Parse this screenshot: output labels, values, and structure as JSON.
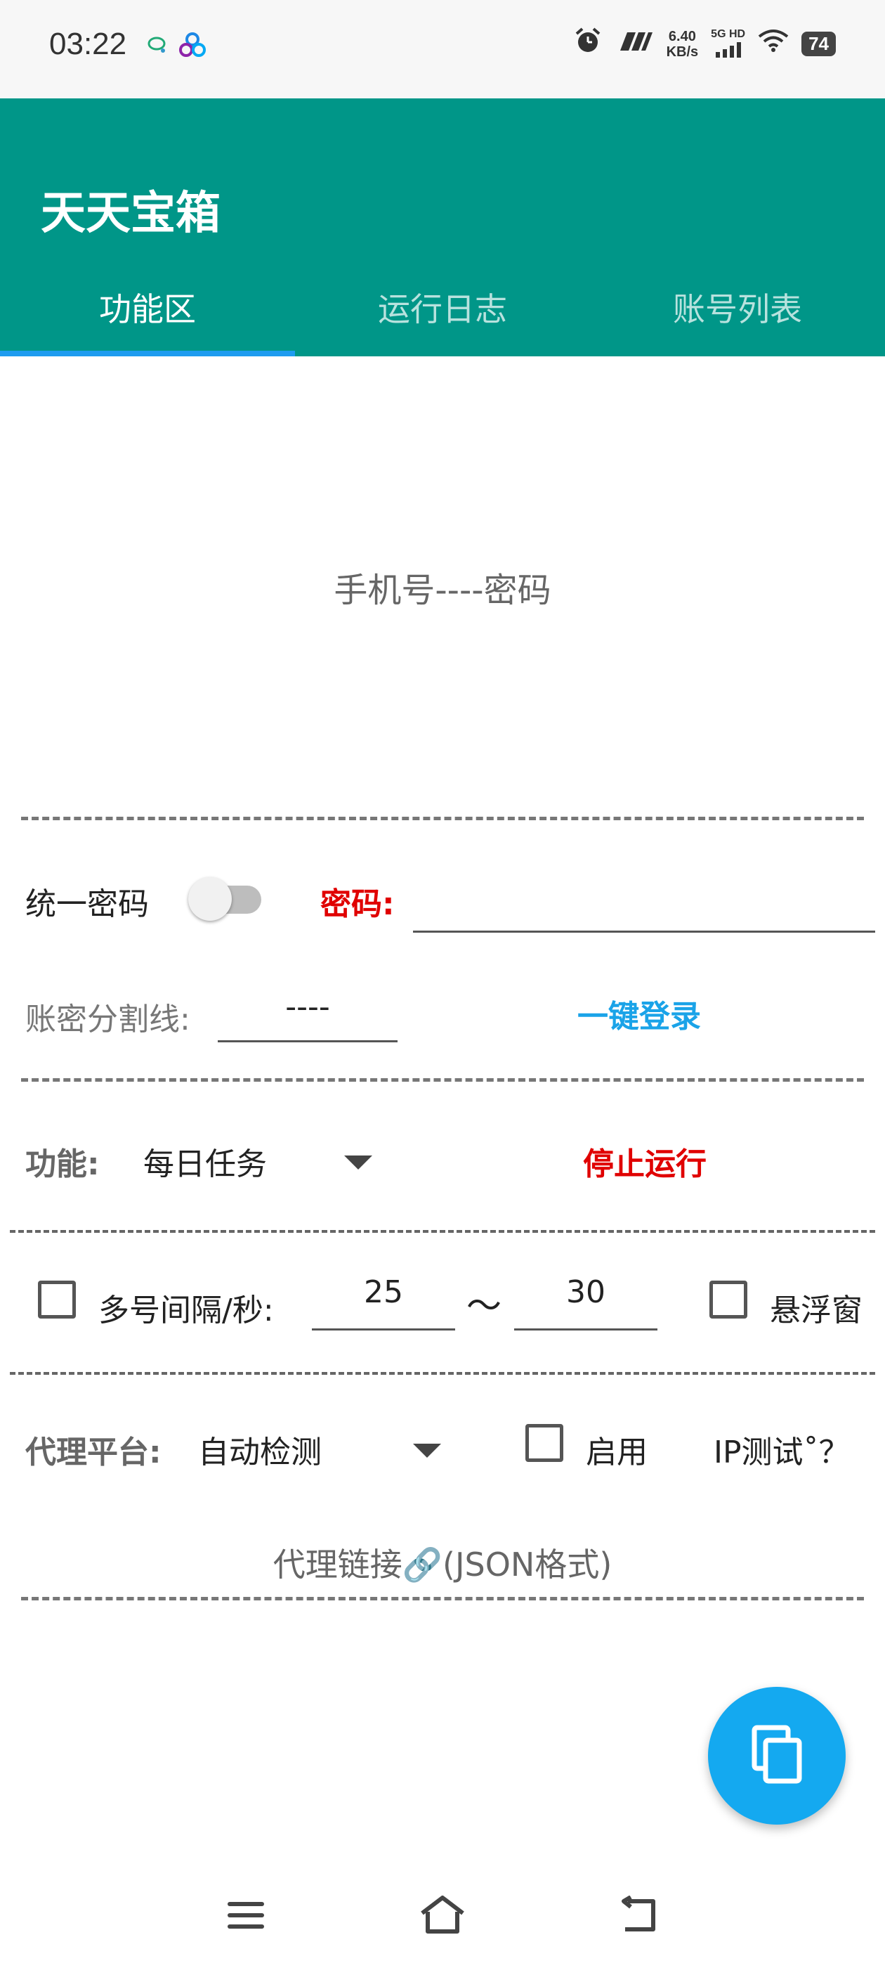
{
  "status_bar": {
    "time": "03:22",
    "net_speed_value": "6.40",
    "net_speed_unit": "KB/s",
    "signal_label": "5G HD",
    "battery": "74",
    "icons": [
      "chat-bubble-icon",
      "app-logo-icon",
      "alarm-icon",
      "sim-icon",
      "signal-icon",
      "wifi-icon",
      "battery-icon"
    ]
  },
  "app": {
    "title": "天天宝箱",
    "accent_color": "#009688",
    "tab_indicator_color": "#1e9cf0"
  },
  "tabs": [
    {
      "label": "功能区",
      "active": true
    },
    {
      "label": "运行日志",
      "active": false
    },
    {
      "label": "账号列表",
      "active": false
    }
  ],
  "account_input": {
    "placeholder": "手机号----密码"
  },
  "unified_password": {
    "label": "统一密码",
    "enabled": false,
    "password_label": "密码:",
    "password_value": ""
  },
  "separator": {
    "label": "账密分割线:",
    "value": "----",
    "login_button": "一键登录"
  },
  "function": {
    "label": "功能:",
    "selected": "每日任务",
    "stop_button": "停止运行"
  },
  "interval": {
    "multi_checkbox_label": "多号间隔/秒:",
    "multi_checked": false,
    "min": "25",
    "tilde": "～",
    "max": "30",
    "float_window_label": "悬浮窗",
    "float_window_checked": false
  },
  "proxy": {
    "label": "代理平台:",
    "selected": "自动检测",
    "enable_label": "启用",
    "enable_checked": false,
    "ip_test": "IP测试˚？",
    "link_placeholder": "代理链接🔗(JSON格式)"
  },
  "fab": {
    "icon": "copy-icon",
    "color": "#14a9f0"
  },
  "navbar": {
    "icons": [
      "menu-icon",
      "home-icon",
      "back-icon"
    ]
  }
}
